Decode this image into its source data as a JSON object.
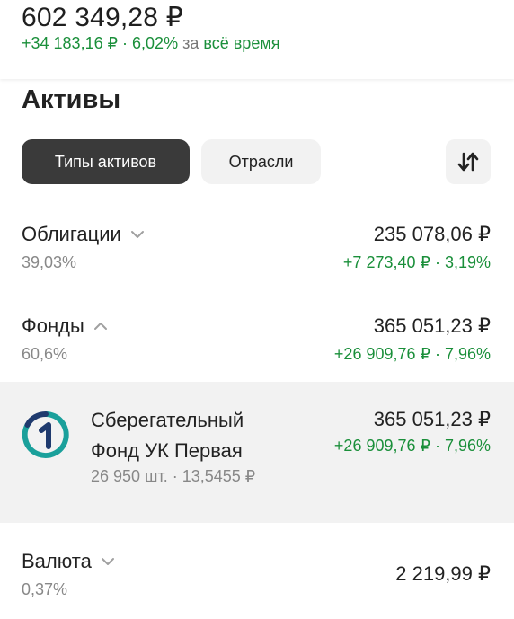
{
  "summary": {
    "total": "602 349,28 ₽",
    "gain_amount": "+34 183,16 ₽ · 6,02%",
    "gain_period_prefix": "за",
    "gain_period": "всё время"
  },
  "assets": {
    "title": "Активы",
    "tabs": [
      "Типы активов",
      "Отрасли"
    ],
    "active_tab": "Типы активов",
    "sort_icon": "sort-arrows-icon"
  },
  "rows": {
    "bonds": {
      "name": "Облигации",
      "percent": "39,03%",
      "value": "235 078,06 ₽",
      "change": "+7 273,40 ₽ · 3,19%",
      "expanded": false
    },
    "funds": {
      "name": "Фонды",
      "percent": "60,6%",
      "value": "365 051,23 ₽",
      "change": "+26 909,76 ₽ · 7,96%",
      "expanded": true
    },
    "currency": {
      "name": "Валюта",
      "percent": "0,37%",
      "value": "2 219,99 ₽",
      "expanded": false
    }
  },
  "fund": {
    "name": "Сберегательный Фонд УК Первая",
    "quantity": "26 950 шт. · 13,5455 ₽",
    "value": "365 051,23 ₽",
    "change": "+26 909,76 ₽ · 7,96%",
    "logo_icon": "pervaya-logo-icon"
  },
  "colors": {
    "positive": "#1a8f3a",
    "active_tab_bg": "#3a3a3a",
    "inactive_bg": "#f2f2f2",
    "logo_teal": "#1aa09b",
    "logo_navy": "#1f3a6e"
  }
}
